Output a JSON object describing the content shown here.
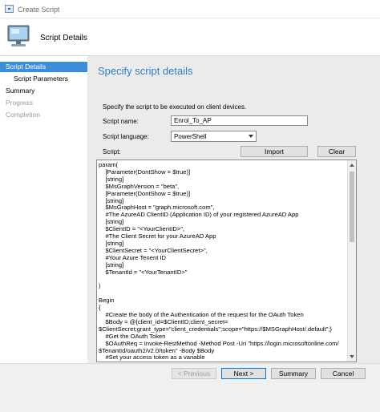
{
  "window": {
    "title": "Create Script"
  },
  "header": {
    "title": "Script Details",
    "icon": "computer-icon"
  },
  "nav": {
    "items": [
      {
        "label": "Script Details",
        "state": "active"
      },
      {
        "label": "Script Parameters",
        "state": "sub"
      },
      {
        "label": "Summary",
        "state": "normal"
      },
      {
        "label": "Progress",
        "state": "disabled"
      },
      {
        "label": "Completion",
        "state": "disabled"
      }
    ]
  },
  "main": {
    "title": "Specify script details",
    "description": "Specify the script to be executed on client devices.",
    "script_name_label": "Script name:",
    "script_name_value": "Enrol_To_AP",
    "script_language_label": "Script language:",
    "script_language_value": "PowerShell",
    "script_label": "Script:",
    "import_label": "Import",
    "clear_label": "Clear",
    "script_text": "param(\n    [Parameter(DontShow = $true)]\n    [string]\n    $MsGraphVersion = \"beta\",\n    [Parameter(DontShow = $true)]\n    [string]\n    $MsGraphHost = \"graph.microsoft.com\",\n    #The AzureAD ClientID (Application ID) of your registered AzureAD App\n    [string]\n    $ClientID = \"<YourClientID>\",\n    #The Client Secret for your AzureAD App\n    [string]\n    $ClientSecret = \"<YourClientSecret>\",\n    #Your Azure Tenent ID\n    [string]\n    $TenantId = \"<YourTenantID>\"\n\n)\n\nBegin\n{\n    #Create the body of the Authentication of the request for the OAuth Token\n    $Body = @{client_id=$ClientID;client_secret=\n$ClientSecret;grant_type=\"client_credentials\";scope=\"https://$MSGraphHost/.default\";}\n    #Get the OAuth Token\n    $OAuthReq = Invoke-RestMethod -Method Post -Uri \"https://login.microsoftonline.com/\n$TenantId/oauth2/v2.0/token\" -Body $Body\n    #Set your access token as a variable\n    $global:AccessToken = $OAuthReq.access_token"
  },
  "footer": {
    "previous_label": "< Previous",
    "next_label": "Next >",
    "summary_label": "Summary",
    "cancel_label": "Cancel"
  }
}
